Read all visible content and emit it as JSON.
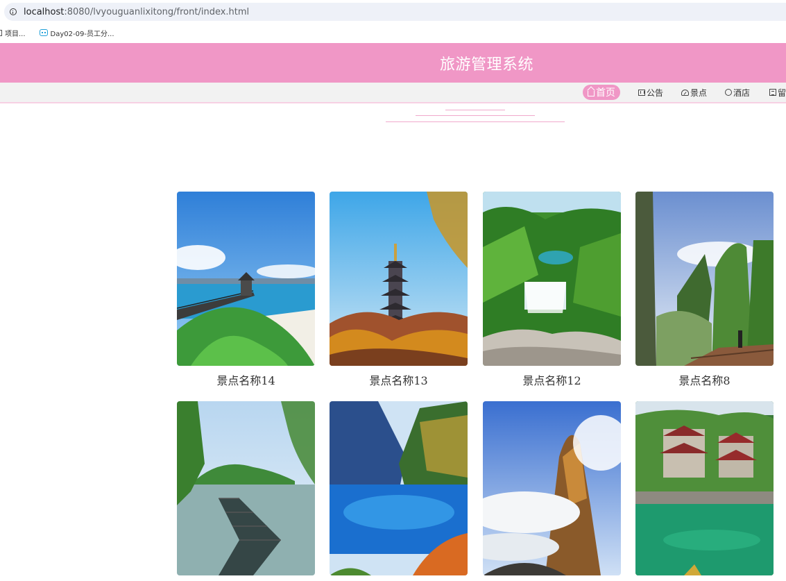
{
  "browser": {
    "url_host": "localhost",
    "url_path": ":8080/lvyouguanlixitong/front/index.html",
    "bookmarks": [
      {
        "label": "项目..."
      },
      {
        "label": "Day02-09-员工分..."
      }
    ]
  },
  "site": {
    "title": "旅游管理系统",
    "accent_color": "#f097c6"
  },
  "nav": {
    "items": [
      {
        "label": "首页",
        "icon": "home-icon",
        "active": true
      },
      {
        "label": "公告",
        "icon": "notice-icon",
        "active": false
      },
      {
        "label": "景点",
        "icon": "gauge-icon",
        "active": false
      },
      {
        "label": "酒店",
        "icon": "ring-icon",
        "active": false
      },
      {
        "label": "留",
        "icon": "message-icon",
        "active": false
      }
    ]
  },
  "attractions": [
    {
      "name": "景点名称14",
      "scene": "coast-boardwalk"
    },
    {
      "name": "景点名称13",
      "scene": "pagoda-autumn"
    },
    {
      "name": "景点名称12",
      "scene": "waterfall-valley"
    },
    {
      "name": "景点名称8",
      "scene": "cliff-viewpoint"
    },
    {
      "name": "",
      "scene": "lake-pier"
    },
    {
      "name": "",
      "scene": "blue-lake"
    },
    {
      "name": "",
      "scene": "mountain-clouds"
    },
    {
      "name": "",
      "scene": "temple-river"
    }
  ]
}
